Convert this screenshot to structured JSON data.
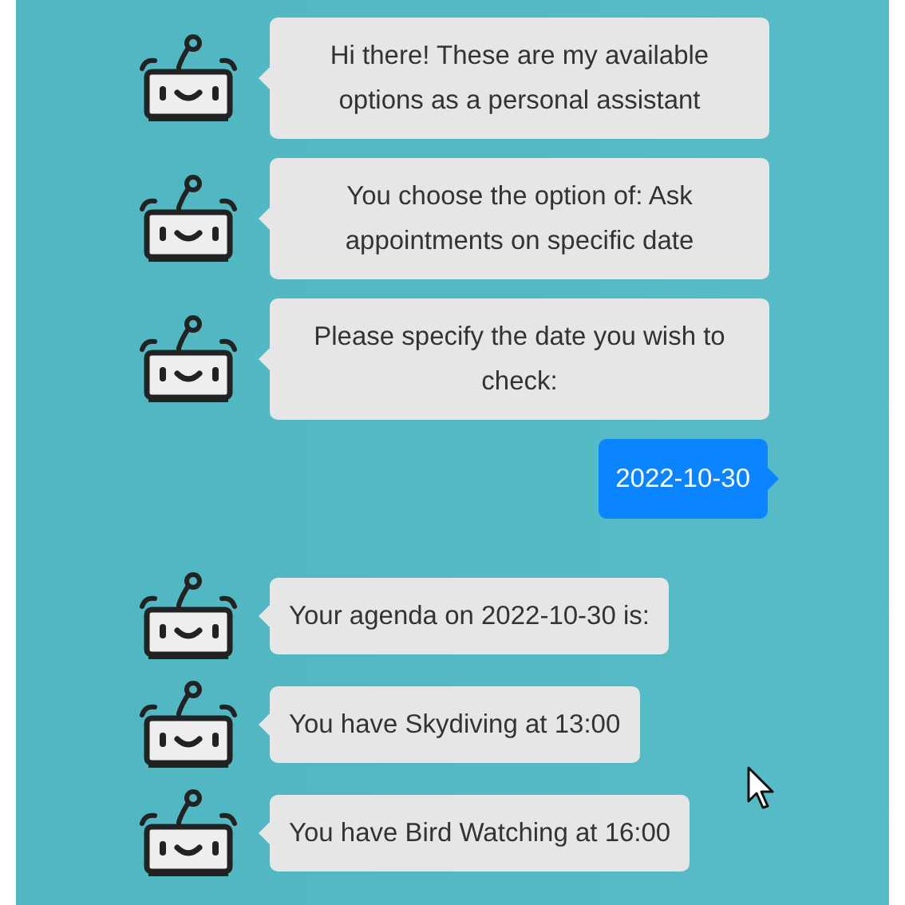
{
  "messages": [
    {
      "kind": "bot",
      "text": "Hi there! These are my available options as a personal assistant"
    },
    {
      "kind": "bot",
      "text": "You choose the option of: Ask appointments on specific date"
    },
    {
      "kind": "bot",
      "text": "Please specify the date you wish to check:"
    },
    {
      "kind": "user",
      "text": "2022-10-30"
    },
    {
      "kind": "bot",
      "text": "Your agenda on 2022-10-30 is:"
    },
    {
      "kind": "bot",
      "text": "You have Skydiving at 13:00"
    },
    {
      "kind": "bot",
      "text": "You have Bird Watching at 16:00"
    }
  ]
}
